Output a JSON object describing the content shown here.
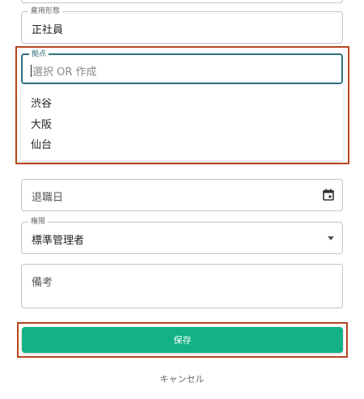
{
  "form": {
    "employment_type": {
      "label": "雇用形態",
      "value": "正社員"
    },
    "base": {
      "label": "拠点",
      "placeholder": "選択 OR 作成",
      "options": [
        "渋谷",
        "大阪",
        "仙台"
      ]
    },
    "retirement_date": {
      "placeholder": "退職日"
    },
    "permission": {
      "label": "権限",
      "value": "標準管理者"
    },
    "notes": {
      "placeholder": "備考"
    }
  },
  "actions": {
    "save_label": "保存",
    "cancel_label": "キャンセル"
  },
  "colors": {
    "accent_green": "#13b286",
    "highlight": "#b5461d",
    "focus": "#2f6f7e"
  }
}
